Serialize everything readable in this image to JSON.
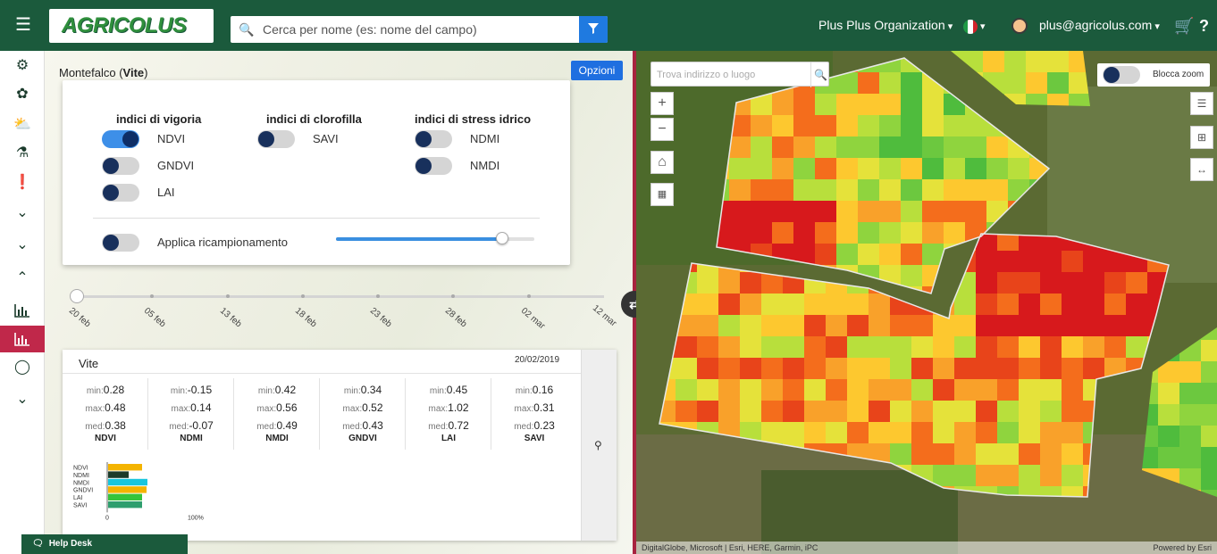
{
  "topbar": {
    "menu_icon": "hamburger-icon",
    "logo": "AGRICOLUS",
    "search_placeholder": "Cerca per nome (es: nome del campo)",
    "organization": "Plus Plus Organization",
    "user_email": "plus@agricolus.com",
    "flag_colors": [
      "#1f9a45",
      "#ffffff",
      "#d2232a"
    ]
  },
  "rail": {
    "icons": [
      "dashboard-icon",
      "leaf-icon",
      "weather-icon",
      "lab-icon",
      "alert-icon",
      "chevron-down-icon",
      "chevron-down-icon",
      "chevron-up-icon",
      "chart-icon",
      "chart-icon-active",
      "bulb-icon",
      "chevron-down-icon"
    ]
  },
  "panel": {
    "field_name": "Montefalco",
    "crop": "Vite",
    "options_label": "Opzioni"
  },
  "options": {
    "groups": [
      {
        "title": "indici di vigoria",
        "items": [
          {
            "label": "NDVI",
            "on": true
          },
          {
            "label": "GNDVI",
            "on": false
          },
          {
            "label": "LAI",
            "on": false
          }
        ]
      },
      {
        "title": "indici di clorofilla",
        "items": [
          {
            "label": "SAVI",
            "on": false
          }
        ]
      },
      {
        "title": "indici di stress idrico",
        "items": [
          {
            "label": "NDMI",
            "on": false
          },
          {
            "label": "NMDI",
            "on": false
          }
        ]
      }
    ],
    "resample_label": "Applica ricampionamento",
    "resample_on": false,
    "resample_level": 0.84
  },
  "timeline": {
    "dates": [
      "20 feb",
      "05 feb",
      "13 feb",
      "18 feb",
      "23 feb",
      "28 feb",
      "02 mar",
      "12 mar"
    ],
    "selected_index": 0
  },
  "stats": {
    "crop": "Vite",
    "date": "20/02/2019",
    "min_label": "min:",
    "max_label": "max:",
    "med_label": "med:",
    "indices": [
      {
        "name": "NDVI",
        "min": "0.28",
        "max": "0.48",
        "med": "0.38"
      },
      {
        "name": "NDMI",
        "min": "-0.15",
        "max": "0.14",
        "med": "-0.07"
      },
      {
        "name": "NMDI",
        "min": "0.42",
        "max": "0.56",
        "med": "0.49"
      },
      {
        "name": "GNDVI",
        "min": "0.34",
        "max": "0.52",
        "med": "0.43"
      },
      {
        "name": "LAI",
        "min": "0.45",
        "max": "1.02",
        "med": "0.72"
      },
      {
        "name": "SAVI",
        "min": "0.16",
        "max": "0.31",
        "med": "0.23"
      }
    ]
  },
  "chart_data": {
    "type": "bar",
    "orientation": "horizontal",
    "categories": [
      "NDVI",
      "NDMI",
      "NMDI",
      "GNDVI",
      "LAI",
      "SAVI"
    ],
    "values": [
      38,
      23,
      44,
      43,
      38,
      38
    ],
    "colors": [
      "#f4b400",
      "#1d3b2a",
      "#19c6de",
      "#f4b400",
      "#36c43b",
      "#2e9e6e"
    ],
    "xlim": [
      0,
      100
    ],
    "tick_labels": [
      "0",
      "100%"
    ]
  },
  "help_desk": {
    "label": "Help Desk",
    "icon": "chat-icon"
  },
  "map": {
    "search_placeholder": "Trova indirizzo o luogo",
    "lock_zoom_label": "Blocca zoom",
    "lock_zoom_on": false,
    "attribution": "DigitalGlobe, Microsoft | Esri, HERE, Garmin, iPC",
    "powered_by": "Powered by Esri",
    "tool_icons": [
      "zoom-in-icon",
      "zoom-out-icon",
      "home-icon",
      "qr-icon"
    ],
    "right_tool_icons": [
      "list-icon",
      "crop-icon",
      "measure-icon"
    ]
  }
}
